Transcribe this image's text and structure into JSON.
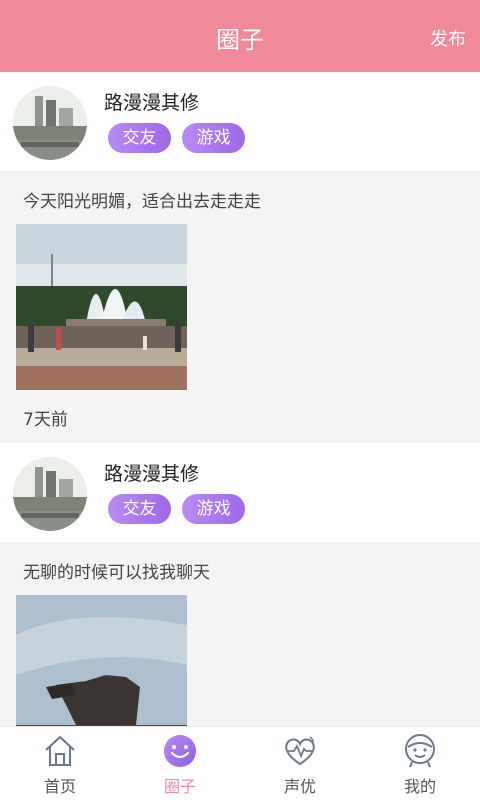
{
  "header": {
    "title": "圈子",
    "publish_label": "发布"
  },
  "posts": [
    {
      "username": "路漫漫其修",
      "tags": [
        "交友",
        "游戏"
      ],
      "text": "今天阳光明媚，适合出去走走走",
      "time": "7天前",
      "image": "fountain-photo"
    },
    {
      "username": "路漫漫其修",
      "tags": [
        "交友",
        "游戏"
      ],
      "text": "无聊的时候可以找我聊天",
      "time": "",
      "image": "sky-sculpture-photo"
    }
  ],
  "tabbar": {
    "items": [
      {
        "label": "首页",
        "icon": "home-icon",
        "active": false
      },
      {
        "label": "圈子",
        "icon": "smile-icon",
        "active": true
      },
      {
        "label": "声优",
        "icon": "heart-pulse-icon",
        "active": false
      },
      {
        "label": "我的",
        "icon": "person-face-icon",
        "active": false
      }
    ]
  },
  "colors": {
    "accent": "#f0899a",
    "tag": "#a56fe9"
  }
}
